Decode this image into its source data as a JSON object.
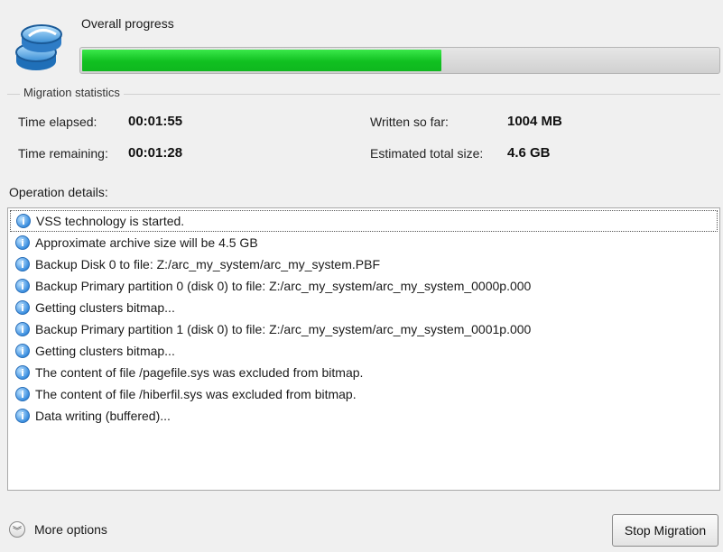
{
  "header": {
    "overall_progress_label": "Overall progress",
    "progress_fraction": 0.565,
    "progress_color": "#10c020",
    "icon": "disk-stack-icon"
  },
  "statistics": {
    "title": "Migration statistics",
    "time_elapsed_label": "Time elapsed:",
    "time_elapsed_value": "00:01:55",
    "time_remaining_label": "Time remaining:",
    "time_remaining_value": "00:01:28",
    "written_label": "Written so far:",
    "written_value": "1004 MB",
    "estimated_label": "Estimated total size:",
    "estimated_value": "4.6 GB"
  },
  "operations": {
    "label": "Operation details:",
    "icon": "info-icon",
    "items": [
      "VSS technology is started.",
      "Approximate archive size will be 4.5 GB",
      "Backup Disk 0 to file: Z:/arc_my_system/arc_my_system.PBF",
      "Backup Primary partition 0 (disk 0) to file: Z:/arc_my_system/arc_my_system_0000p.000",
      "Getting clusters bitmap...",
      "Backup Primary partition 1 (disk 0) to file: Z:/arc_my_system/arc_my_system_0001p.000",
      "Getting clusters bitmap...",
      "The content of file /pagefile.sys was excluded from bitmap.",
      "The content of file /hiberfil.sys was excluded from bitmap.",
      "Data writing (buffered)..."
    ]
  },
  "footer": {
    "more_options_label": "More options",
    "more_icon": "double-chevron-down-icon",
    "stop_button_label": "Stop Migration"
  }
}
